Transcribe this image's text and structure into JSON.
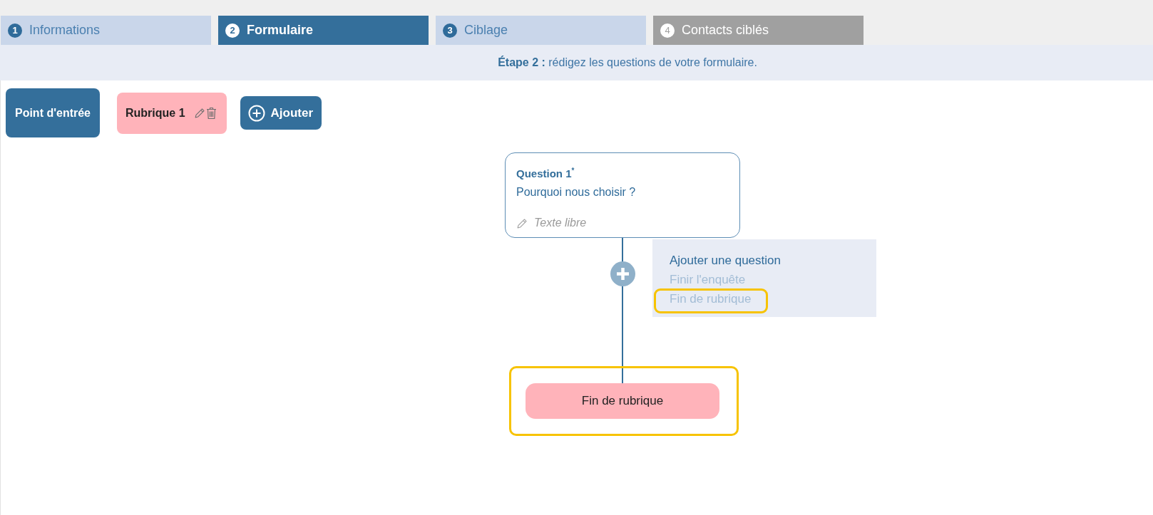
{
  "tabs": [
    {
      "number": "1",
      "label": "Informations",
      "selected": false,
      "disabled": false
    },
    {
      "number": "2",
      "label": "Formulaire",
      "selected": true,
      "disabled": false
    },
    {
      "number": "3",
      "label": "Ciblage",
      "selected": false,
      "disabled": false
    },
    {
      "number": "4",
      "label": "Contacts ciblés",
      "selected": false,
      "disabled": true
    }
  ],
  "step_banner": {
    "text": "**Étape 2 :** rédigez les questions de votre formulaire."
  },
  "toolbar": {
    "entry_point": {
      "label": "Point d'entrée"
    },
    "sections": [
      {
        "label": "Rubrique 1"
      }
    ],
    "add_button": {
      "label": "Ajouter"
    }
  },
  "flow": {
    "question": {
      "title": "Question 1$^{*}$",
      "text": "Pourquoi nous choisir ?",
      "answer_type": "Texte libre"
    },
    "add_menu": {
      "items": [
        {
          "label": "Ajouter une question",
          "disabled": false,
          "highlighted": false
        },
        {
          "label": "Finir l'enquête",
          "disabled": true,
          "highlighted": false
        },
        {
          "label": "Fin de rubrique",
          "disabled": true,
          "highlighted": true
        }
      ]
    },
    "end_node": {
      "label": "Fin de rubrique",
      "highlighted": true
    }
  }
}
